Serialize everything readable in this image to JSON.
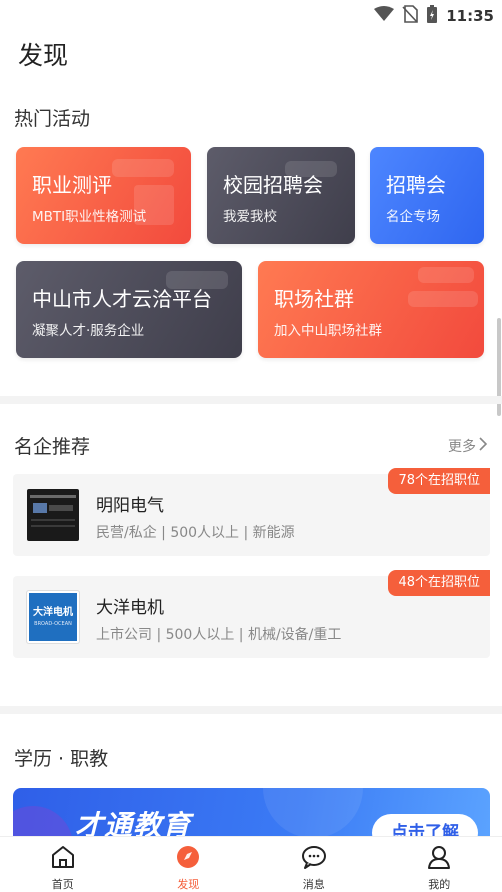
{
  "status_bar": {
    "time": "11:35",
    "icons": [
      "wifi-icon",
      "no-sim-icon",
      "battery-charging-icon"
    ]
  },
  "page": {
    "title": "发现"
  },
  "hot_activities": {
    "title": "热门活动",
    "cards": [
      {
        "title": "职业测评",
        "subtitle": "MBTI职业性格测试",
        "style": "red"
      },
      {
        "title": "校园招聘会",
        "subtitle": "我爱我校",
        "style": "dark"
      },
      {
        "title": "招聘会",
        "subtitle": "名企专场",
        "style": "blue"
      },
      {
        "title": "中山市人才云洽平台",
        "subtitle": "凝聚人才·服务企业",
        "style": "dark"
      },
      {
        "title": "职场社群",
        "subtitle": "加入中山职场社群",
        "style": "red"
      }
    ]
  },
  "companies": {
    "title": "名企推荐",
    "more_label": "更多",
    "items": [
      {
        "name": "明阳电气",
        "info": "民营/私企 | 500人以上 | 新能源",
        "badge": "78个在招职位"
      },
      {
        "name": "大洋电机",
        "info": "上市公司 | 500人以上 | 机械/设备/重工",
        "badge": "48个在招职位",
        "logo_text": "大洋电机",
        "logo_sub": "BROAD-OCEAN"
      }
    ]
  },
  "education": {
    "title": "学历 · 职教",
    "banner_title": "才通教育",
    "banner_button": "点击了解"
  },
  "tabbar": {
    "items": [
      {
        "label": "首页",
        "icon": "home-icon",
        "active": false
      },
      {
        "label": "发现",
        "icon": "discover-icon",
        "active": true
      },
      {
        "label": "消息",
        "icon": "message-icon",
        "active": false
      },
      {
        "label": "我的",
        "icon": "profile-icon",
        "active": false
      }
    ]
  },
  "colors": {
    "accent": "#f55f3b",
    "card_red": "#f24a3d",
    "card_dark": "#45444f",
    "card_blue": "#2f66f0"
  }
}
